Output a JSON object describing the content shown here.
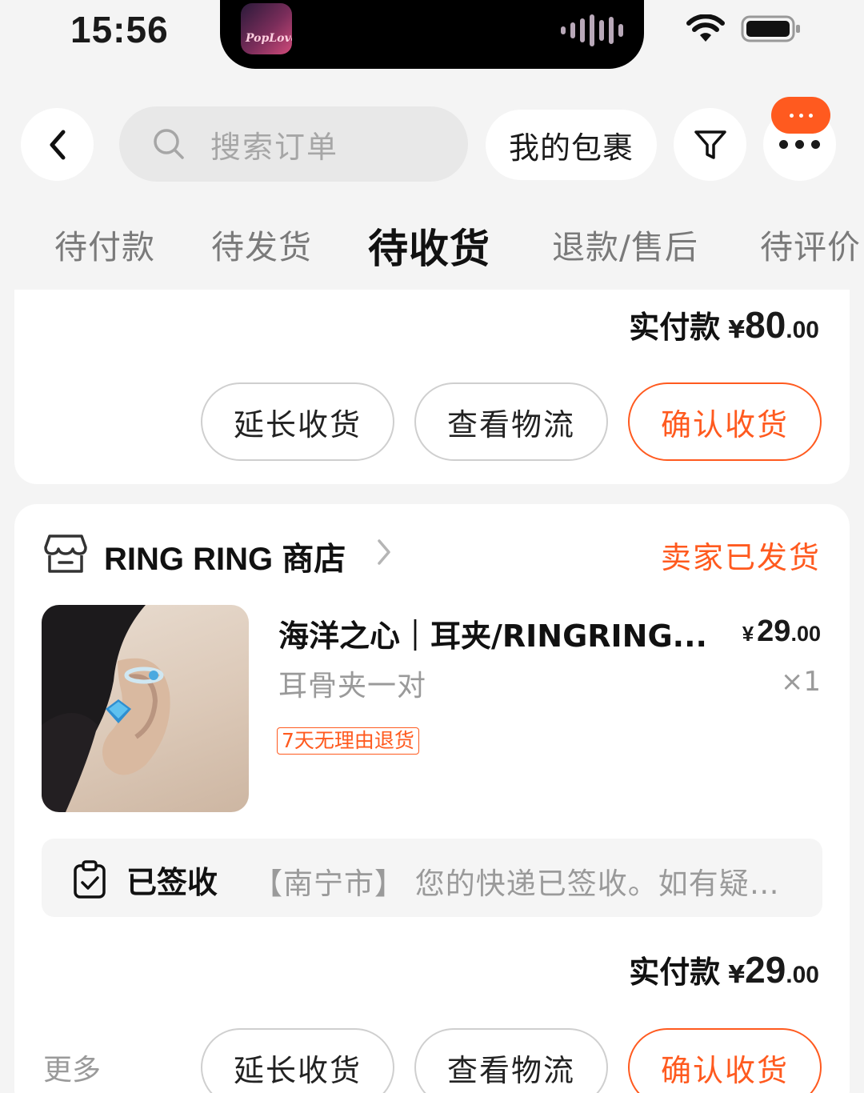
{
  "status_bar": {
    "time": "15:56",
    "now_playing_art_text": "PopLove"
  },
  "header": {
    "search": {
      "placeholder": "搜索订单"
    },
    "packages_label": "我的包裹"
  },
  "tabs": [
    {
      "label": "待付款",
      "active": false
    },
    {
      "label": "待发货",
      "active": false
    },
    {
      "label": "待收货",
      "active": true
    },
    {
      "label": "退款/售后",
      "active": false
    },
    {
      "label": "待评价",
      "active": false
    }
  ],
  "orders": [
    {
      "paid_label": "实付款",
      "paid_currency": "¥",
      "paid_int": "80",
      "paid_dec": ".00",
      "actions": [
        "延长收货",
        "查看物流",
        "确认收货"
      ]
    },
    {
      "shop_name": "RING RING 商店",
      "status": "卖家已发货",
      "product": {
        "title": "海洋之心｜耳夹/RINGRING...",
        "spec": "耳骨夹一对",
        "price_currency": "¥",
        "price_int": "29",
        "price_dec": ".00",
        "qty": "×1",
        "tag": "7天无理由退货"
      },
      "tracking": {
        "status": "已签收",
        "text": "【南宁市】 您的快递已签收。如有疑…"
      },
      "paid_label": "实付款",
      "paid_currency": "¥",
      "paid_int": "29",
      "paid_dec": ".00",
      "more_label": "更多",
      "actions": [
        "延长收货",
        "查看物流",
        "确认收货"
      ]
    }
  ],
  "colors": {
    "accent": "#ff5a1f",
    "page_bg": "#f4f4f4",
    "card_bg": "#ffffff",
    "muted_text": "#9a9a9a"
  }
}
